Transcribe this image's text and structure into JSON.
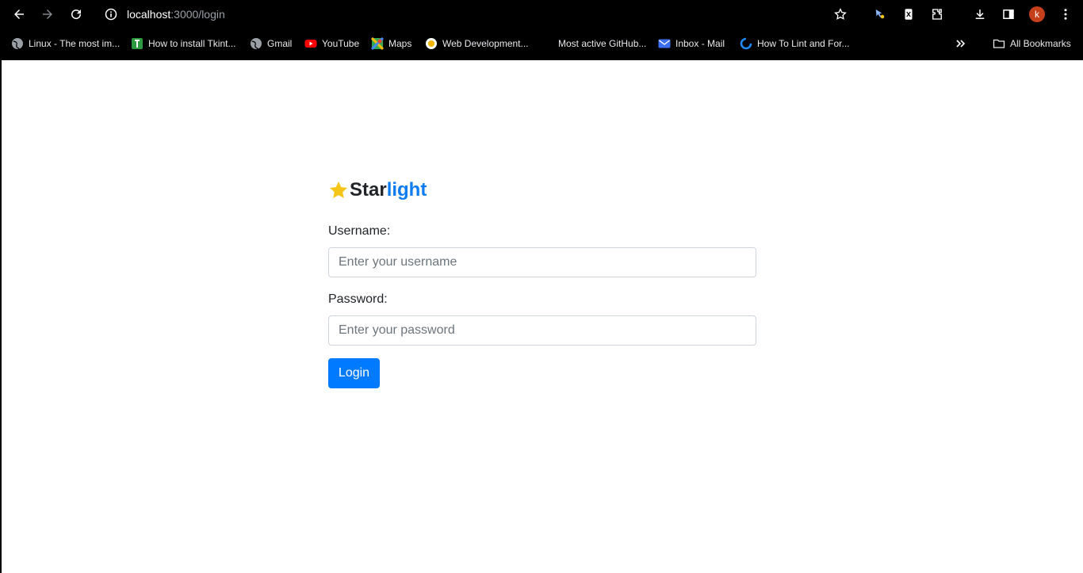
{
  "browser": {
    "url_host": "localhost",
    "url_path": ":3000/login",
    "profile_initial": "k",
    "bookmarks": [
      {
        "label": "Linux - The most im...",
        "icon": "globe-icon"
      },
      {
        "label": "How to install Tkint...",
        "icon": "site-icon"
      },
      {
        "label": "Gmail",
        "icon": "globe-icon"
      },
      {
        "label": "YouTube",
        "icon": "youtube-icon"
      },
      {
        "label": "Maps",
        "icon": "maps-icon"
      },
      {
        "label": "Web Development...",
        "icon": "site-icon"
      },
      {
        "label": "Most active GitHub...",
        "icon": ""
      },
      {
        "label": "Inbox - Mail",
        "icon": "mail-icon"
      },
      {
        "label": "How To Lint and For...",
        "icon": "site-icon"
      }
    ],
    "all_bookmarks_label": "All Bookmarks"
  },
  "page": {
    "brand_part1": "Star",
    "brand_part2": "light",
    "username_label": "Username:",
    "username_placeholder": "Enter your username",
    "password_label": "Password:",
    "password_placeholder": "Enter your password",
    "login_label": "Login"
  },
  "colors": {
    "accent": "#007bff",
    "brand_light": "#0d7cf2",
    "star": "#f5c518"
  }
}
